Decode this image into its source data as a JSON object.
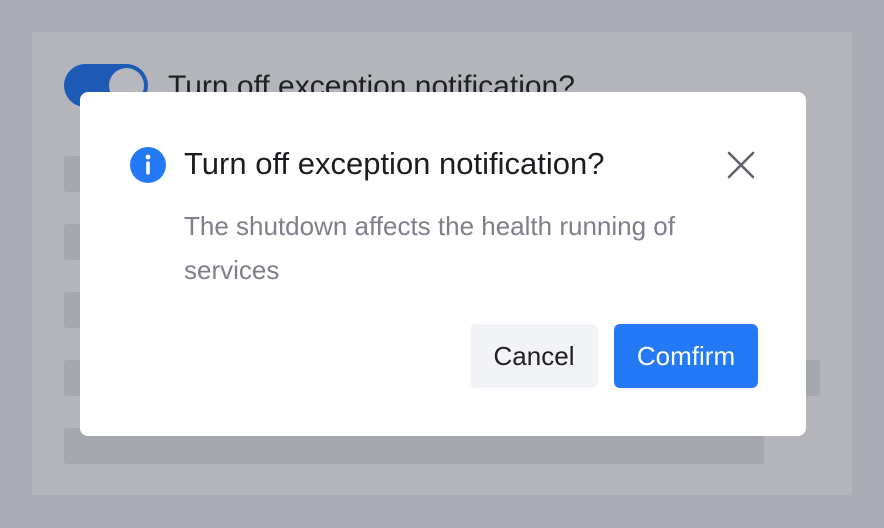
{
  "background": {
    "toggle_on": true,
    "title": "Turn off exception notification?"
  },
  "dialog": {
    "icon": "info-icon",
    "title": "Turn off exception notification?",
    "body": "The shutdown affects the health running of services",
    "close_icon": "close-icon",
    "cancel_label": "Cancel",
    "confirm_label": "Comfirm"
  },
  "colors": {
    "accent": "#2379f6",
    "overlay": "#a9acb4",
    "body_text": "#7d808a"
  }
}
